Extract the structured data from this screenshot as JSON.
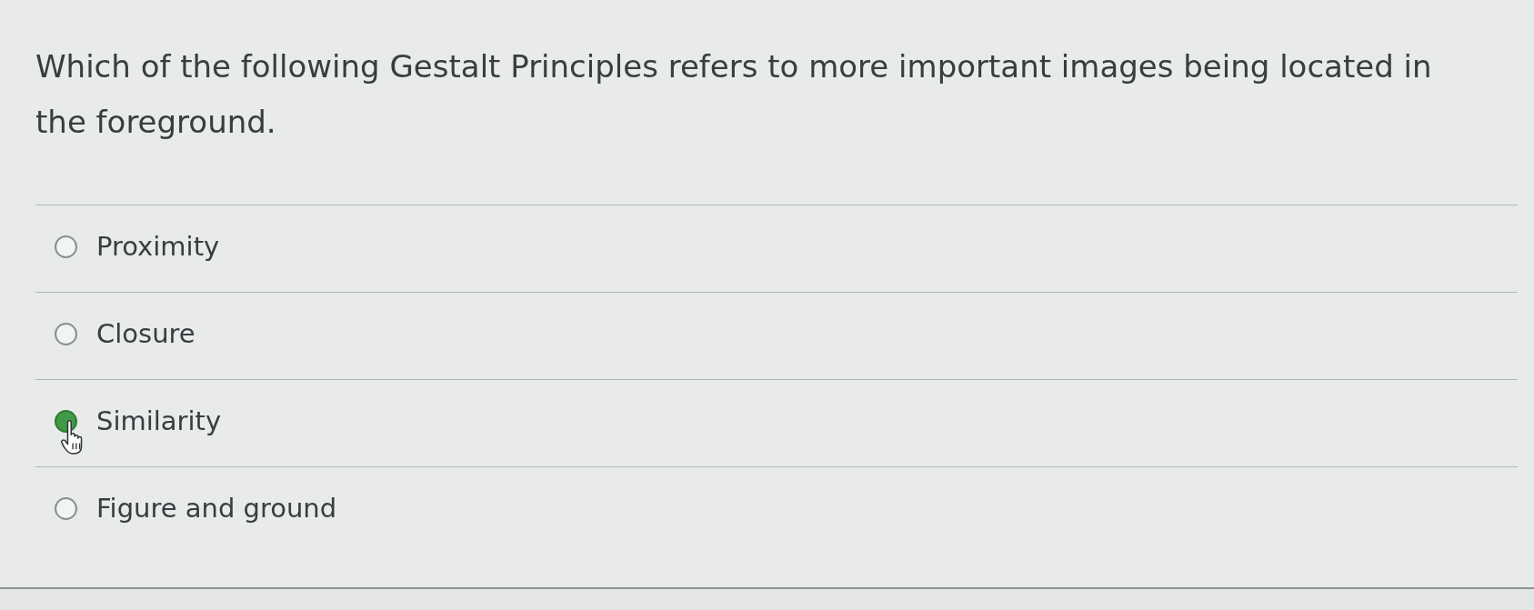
{
  "question": {
    "text": "Which of the following Gestalt Principles refers to more important images being located in the foreground."
  },
  "options": [
    {
      "label": "Proximity",
      "selected": false
    },
    {
      "label": "Closure",
      "selected": false
    },
    {
      "label": "Similarity",
      "selected": true
    },
    {
      "label": "Figure and ground",
      "selected": false
    }
  ]
}
